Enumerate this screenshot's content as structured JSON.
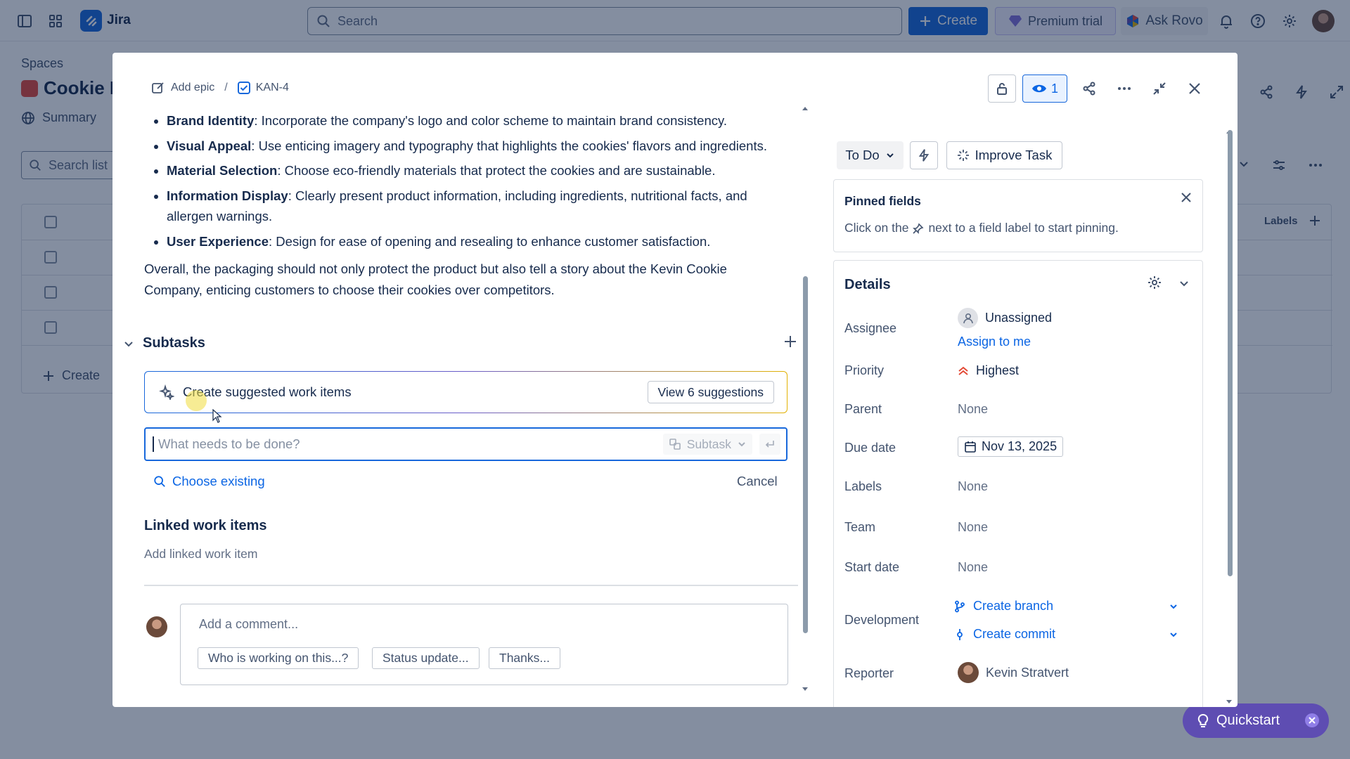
{
  "app": {
    "name": "Jira"
  },
  "topnav": {
    "search_placeholder": "Search",
    "create_label": "Create",
    "premium_label": "Premium trial",
    "rovo_label": "Ask Rovo"
  },
  "background": {
    "spaces_label": "Spaces",
    "project_title": "Cookie B",
    "summary_tab": "Summary",
    "search_placeholder": "Search list",
    "labels_header": "Labels",
    "create_label": "Create"
  },
  "modal": {
    "breadcrumb": {
      "add_epic": "Add epic",
      "separator": "/",
      "issue_key": "KAN-4"
    },
    "watch_count": "1",
    "description": {
      "items": [
        {
          "term": "Brand Identity",
          "text": ": Incorporate the company's logo and color scheme to maintain brand consistency."
        },
        {
          "term": "Visual Appeal",
          "text": ": Use enticing imagery and typography that highlights the cookies' flavors and ingredients."
        },
        {
          "term": "Material Selection",
          "text": ": Choose eco-friendly materials that protect the cookies and are sustainable."
        },
        {
          "term": "Information Display",
          "text": ": Clearly present product information, including ingredients, nutritional facts, and allergen warnings."
        },
        {
          "term": "User Experience",
          "text": ": Design for ease of opening and resealing to enhance customer satisfaction."
        }
      ],
      "summary": "Overall, the packaging should not only protect the product but also tell a story about the Kevin Cookie Company, enticing customers to choose their cookies over competitors."
    },
    "subtasks": {
      "title": "Subtasks",
      "suggest_label": "Create suggested work items",
      "view_suggestions": "View 6 suggestions",
      "input_placeholder": "What needs to be done?",
      "type_label": "Subtask",
      "choose_existing": "Choose existing",
      "cancel": "Cancel"
    },
    "linked": {
      "title": "Linked work items",
      "add": "Add linked work item"
    },
    "comment": {
      "placeholder": "Add a comment...",
      "chips": [
        "Who is working on this...?",
        "Status update...",
        "Thanks..."
      ]
    },
    "status": {
      "label": "To Do",
      "improve": "Improve Task"
    },
    "pinned": {
      "title": "Pinned fields",
      "desc_before": "Click on the",
      "desc_after": "next to a field label to start pinning."
    },
    "details": {
      "title": "Details",
      "assignee_label": "Assignee",
      "assignee_value": "Unassigned",
      "assign_to_me": "Assign to me",
      "priority_label": "Priority",
      "priority_value": "Highest",
      "parent_label": "Parent",
      "parent_value": "None",
      "due_label": "Due date",
      "due_value": "Nov 13, 2025",
      "labels_label": "Labels",
      "labels_value": "None",
      "team_label": "Team",
      "team_value": "None",
      "start_label": "Start date",
      "start_value": "None",
      "dev_label": "Development",
      "create_branch": "Create branch",
      "create_commit": "Create commit",
      "reporter_label": "Reporter",
      "reporter_value": "Kevin Stratvert"
    }
  },
  "quickstart": {
    "label": "Quickstart"
  },
  "colors": {
    "brand": "#1868db",
    "priority_highest": "#e34935",
    "quickstart": "#5e4db2"
  }
}
